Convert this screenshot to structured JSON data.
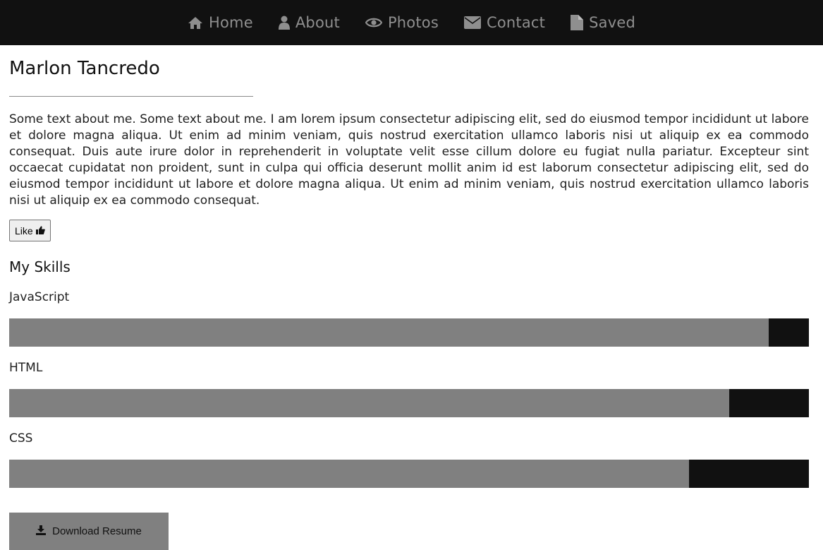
{
  "nav": {
    "items": [
      {
        "label": "Home",
        "icon": "home-icon"
      },
      {
        "label": "About",
        "icon": "user-icon"
      },
      {
        "label": "Photos",
        "icon": "eye-icon"
      },
      {
        "label": "Contact",
        "icon": "envelope-icon"
      },
      {
        "label": "Saved",
        "icon": "file-icon"
      }
    ]
  },
  "profile": {
    "name": "Marlon Tancredo",
    "about": "Some text about me. Some text about me. I am lorem ipsum consectetur adipiscing elit, sed do eiusmod tempor incididunt ut labore et dolore magna aliqua. Ut enim ad minim veniam, quis nostrud exercitation ullamco laboris nisi ut aliquip ex ea commodo consequat. Duis aute irure dolor in reprehenderit in voluptate velit esse cillum dolore eu fugiat nulla pariatur. Excepteur sint occaecat cupidatat non proident, sunt in culpa qui officia deserunt mollit anim id est laborum consectetur adipiscing elit, sed do eiusmod tempor incididunt ut labore et dolore magna aliqua. Ut enim ad minim veniam, quis nostrud exercitation ullamco laboris nisi ut aliquip ex ea commodo consequat.",
    "like_label": "Like"
  },
  "skills": {
    "title": "My Skills",
    "items": [
      {
        "name": "JavaScript",
        "level": 0.95
      },
      {
        "name": "HTML",
        "level": 0.9
      },
      {
        "name": "CSS",
        "level": 0.85
      }
    ]
  },
  "download": {
    "label": "Download Resume",
    "icon": "download-icon"
  },
  "colors": {
    "nav_bg": "#111111",
    "nav_text": "#8f8f8f",
    "bar_fill": "#808080",
    "bar_track": "#111111"
  }
}
